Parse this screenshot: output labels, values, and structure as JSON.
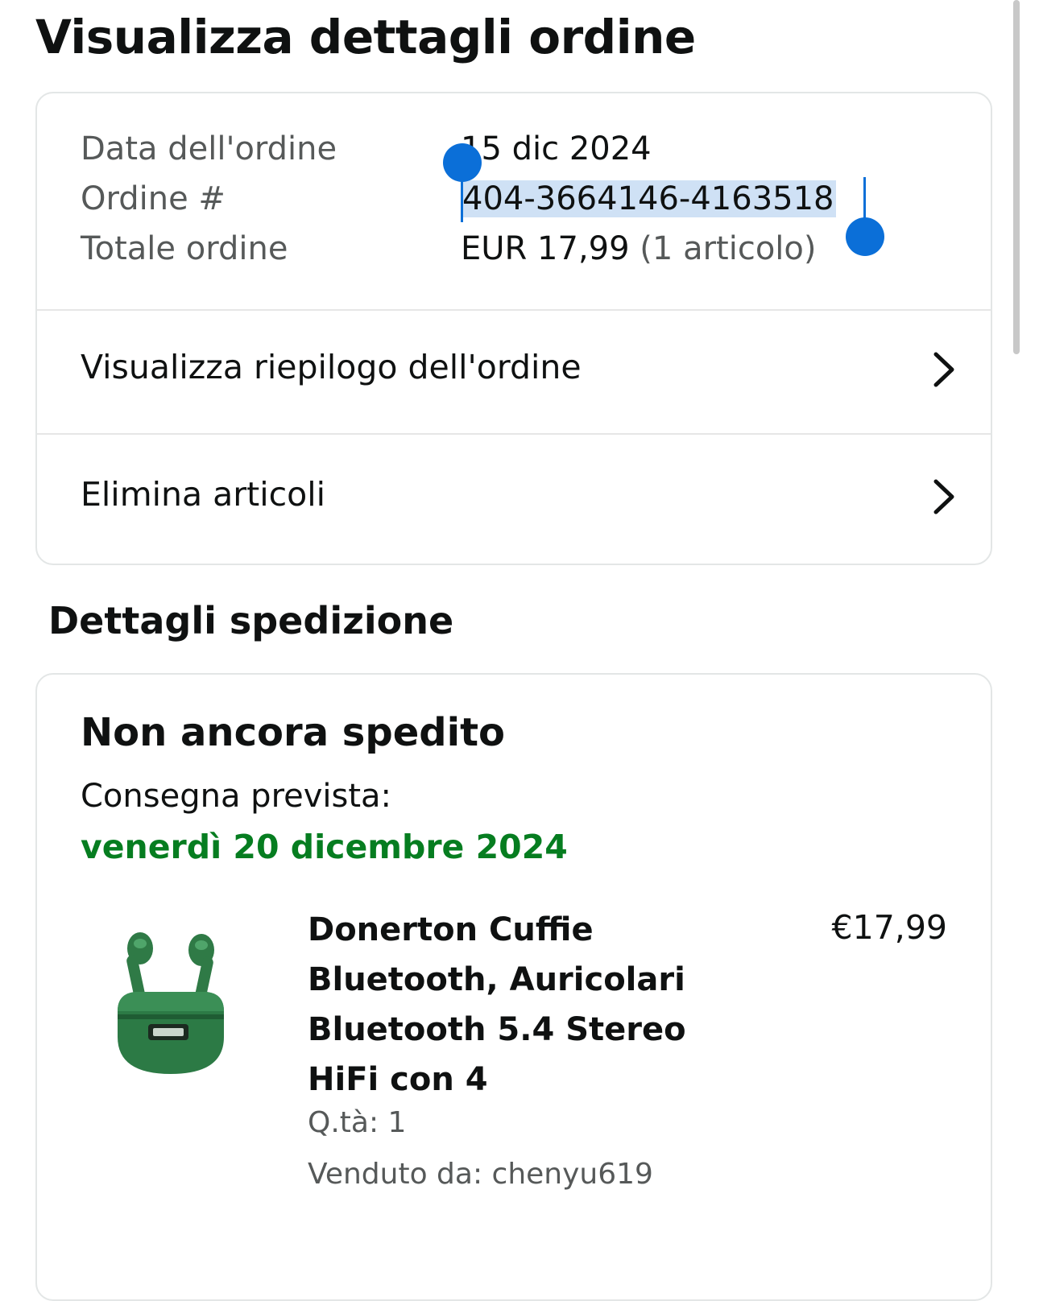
{
  "page": {
    "title": "Visualizza dettagli ordine"
  },
  "order_summary": {
    "date_label": "Data dell'ordine",
    "date_value": "15 dic 2024",
    "number_label": "Ordine #",
    "number_value": "404-3664146-4163518",
    "total_label": "Totale ordine",
    "total_amount": "EUR 17,99",
    "total_items": "(1 articolo)"
  },
  "nav": {
    "view_summary": "Visualizza riepilogo dell'ordine",
    "delete_items": "Elimina articoli"
  },
  "shipping": {
    "section_title": "Dettagli spedizione",
    "status": "Non ancora spedito",
    "expected_label": "Consegna prevista:",
    "expected_date": "venerdì 20 dicembre 2024",
    "item": {
      "title": "Donerton Cuffie Bluetooth, Auricolari Bluetooth 5.4 Stereo HiFi con 4",
      "price": "€17,99",
      "quantity": "Q.tà: 1",
      "seller": "Venduto da: chenyu619"
    }
  },
  "colors": {
    "text_primary": "#0f1111",
    "text_secondary": "#565959",
    "delivery_green": "#067d20",
    "selection_blue": "#0b6fd8",
    "selection_highlight": "#cfe1f5",
    "product_green": "#2e7d4a"
  }
}
